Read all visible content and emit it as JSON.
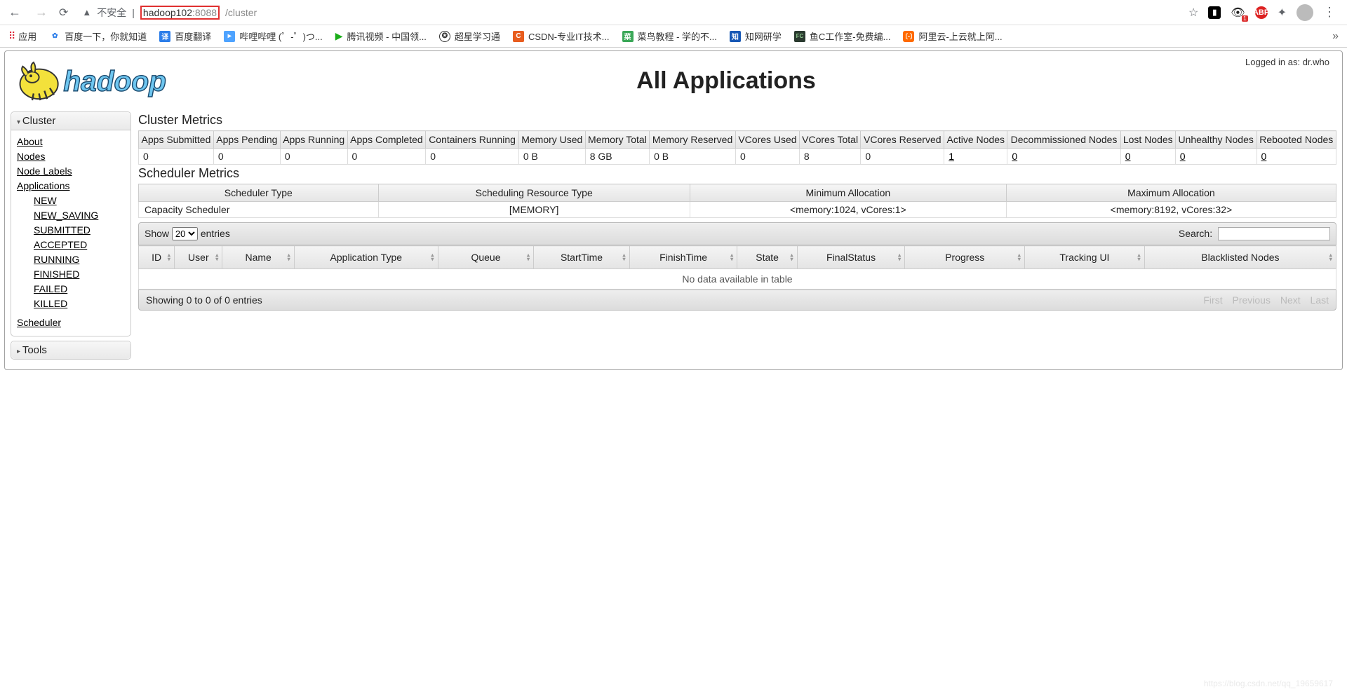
{
  "browser": {
    "insecure_label": "不安全",
    "url_host": "hadoop102",
    "url_port": ":8088",
    "url_path": "/cluster",
    "apps_label": "应用"
  },
  "bookmarks": [
    {
      "label": "百度一下，你就知道"
    },
    {
      "label": "百度翻译"
    },
    {
      "label": "哔哩哔哩 (゜-゜)つ..."
    },
    {
      "label": "腾讯视频 - 中国领..."
    },
    {
      "label": "超星学习通"
    },
    {
      "label": "CSDN-专业IT技术..."
    },
    {
      "label": "菜鸟教程 - 学的不..."
    },
    {
      "label": "知网研学"
    },
    {
      "label": "鱼C工作室-免费编..."
    },
    {
      "label": "阿里云-上云就上阿..."
    }
  ],
  "login_text": "Logged in as: dr.who",
  "page_title": "All Applications",
  "sidebar": {
    "cluster_title": "Cluster",
    "tools_title": "Tools",
    "links": {
      "about": "About",
      "nodes": "Nodes",
      "node_labels": "Node Labels",
      "applications": "Applications",
      "scheduler": "Scheduler"
    },
    "app_sublinks": [
      "NEW",
      "NEW_SAVING",
      "SUBMITTED",
      "ACCEPTED",
      "RUNNING",
      "FINISHED",
      "FAILED",
      "KILLED"
    ]
  },
  "cluster_metrics": {
    "heading": "Cluster Metrics",
    "headers": [
      "Apps Submitted",
      "Apps Pending",
      "Apps Running",
      "Apps Completed",
      "Containers Running",
      "Memory Used",
      "Memory Total",
      "Memory Reserved",
      "VCores Used",
      "VCores Total",
      "VCores Reserved",
      "Active Nodes",
      "Decommissioned Nodes",
      "Lost Nodes",
      "Unhealthy Nodes",
      "Rebooted Nodes"
    ],
    "values": [
      "0",
      "0",
      "0",
      "0",
      "0",
      "0 B",
      "8 GB",
      "0 B",
      "0",
      "8",
      "0",
      "1",
      "0",
      "0",
      "0",
      "0"
    ]
  },
  "scheduler_metrics": {
    "heading": "Scheduler Metrics",
    "headers": [
      "Scheduler Type",
      "Scheduling Resource Type",
      "Minimum Allocation",
      "Maximum Allocation"
    ],
    "values": [
      "Capacity Scheduler",
      "[MEMORY]",
      "<memory:1024, vCores:1>",
      "<memory:8192, vCores:32>"
    ]
  },
  "apps_table": {
    "show_label": "Show",
    "entries_label": "entries",
    "entries_value": "20",
    "search_label": "Search:",
    "headers": [
      "ID",
      "User",
      "Name",
      "Application Type",
      "Queue",
      "StartTime",
      "FinishTime",
      "State",
      "FinalStatus",
      "Progress",
      "Tracking UI",
      "Blacklisted Nodes"
    ],
    "empty_text": "No data available in table",
    "info_text": "Showing 0 to 0 of 0 entries",
    "pagination": {
      "first": "First",
      "prev": "Previous",
      "next": "Next",
      "last": "Last"
    }
  },
  "watermark": "https://blog.csdn.net/qq_19659617"
}
